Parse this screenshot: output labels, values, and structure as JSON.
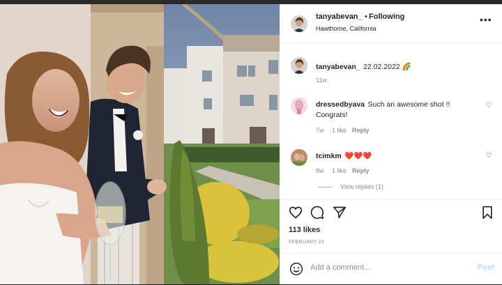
{
  "post": {
    "author": "tanyabevan_",
    "follow_state": "Following",
    "separator": "•",
    "location": "Hawthorne, California",
    "more_icon": "more-options-icon",
    "caption_user": "tanyabevan_",
    "caption_text": "22.02.2022 🌈",
    "caption_age": "11w"
  },
  "comments": [
    {
      "user": "dressedbyava",
      "text": "Such an awesome shot !! Congrats!",
      "age": "7w",
      "likes": "1 like",
      "reply_label": "Reply"
    },
    {
      "user": "tcimkm",
      "text": "❤️❤️❤️",
      "age": "8w",
      "likes": "1 like",
      "reply_label": "Reply",
      "view_replies": "View replies (1)"
    }
  ],
  "footer": {
    "likes_count": "113 likes",
    "date": "FEBRUARY 23",
    "comment_placeholder": "Add a comment...",
    "post_label": "Post"
  },
  "colors": {
    "link_disabled": "#b2dffc",
    "muted": "#8e8e8e",
    "text": "#262626"
  }
}
